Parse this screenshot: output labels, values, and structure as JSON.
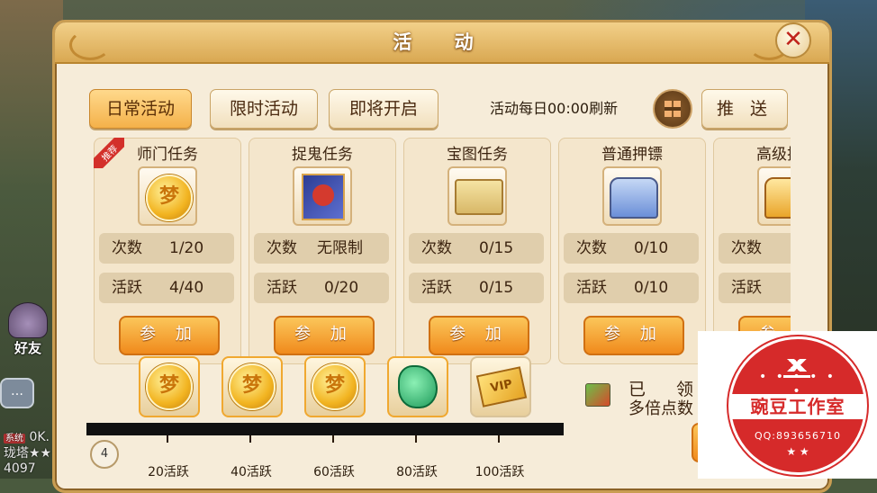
{
  "window": {
    "title": "活 动"
  },
  "tabs": [
    {
      "label": "日常活动",
      "active": true
    },
    {
      "label": "限时活动",
      "active": false
    },
    {
      "label": "即将开启",
      "active": false
    }
  ],
  "refresh_text": "活动每日00:00刷新",
  "push_label": "推 送",
  "recommend_badge": "推荐",
  "labels": {
    "count": "次数",
    "activity": "活跃",
    "join": "参 加"
  },
  "activities": [
    {
      "name": "师门任务",
      "icon": "gold-dream-coin-icon",
      "count": "1/20",
      "activity": "4/40"
    },
    {
      "name": "捉鬼任务",
      "icon": "ghost-book-icon",
      "count": "无限制",
      "activity": "0/20"
    },
    {
      "name": "宝图任务",
      "icon": "treasure-map-icon",
      "count": "0/15",
      "activity": "0/15"
    },
    {
      "name": "普通押镖",
      "icon": "silver-chest-icon",
      "count": "0/10",
      "activity": "0/10"
    },
    {
      "name": "高级押镖",
      "icon": "gold-chest-icon",
      "count": "",
      "activity": ""
    }
  ],
  "rewards": [
    {
      "label": "20活跃",
      "icon": "gold-dream-coin-icon"
    },
    {
      "label": "40活跃",
      "icon": "gold-dream-coin-icon"
    },
    {
      "label": "60活跃",
      "icon": "gold-dream-coin-icon"
    },
    {
      "label": "80活跃",
      "icon": "jade-icon"
    },
    {
      "label": "100活跃",
      "icon": "vip-card-icon"
    }
  ],
  "activity_level": "4",
  "claimed_text": "已 领 取",
  "multiplier_text": "多倍点数",
  "side": {
    "friend_label": "好友",
    "chat_line1": "0K.",
    "chat_tag": "系统",
    "chat_line2": "珑塔★★",
    "chat_line3": "4097"
  },
  "watermark": {
    "name": "豌豆工作室",
    "qq": "QQ:893656710",
    "stars": "★  ★"
  },
  "colors": {
    "accent": "#f08a1c",
    "panel": "#f6ecd9",
    "title": "#d9a852",
    "stamp": "#d62a2a"
  }
}
